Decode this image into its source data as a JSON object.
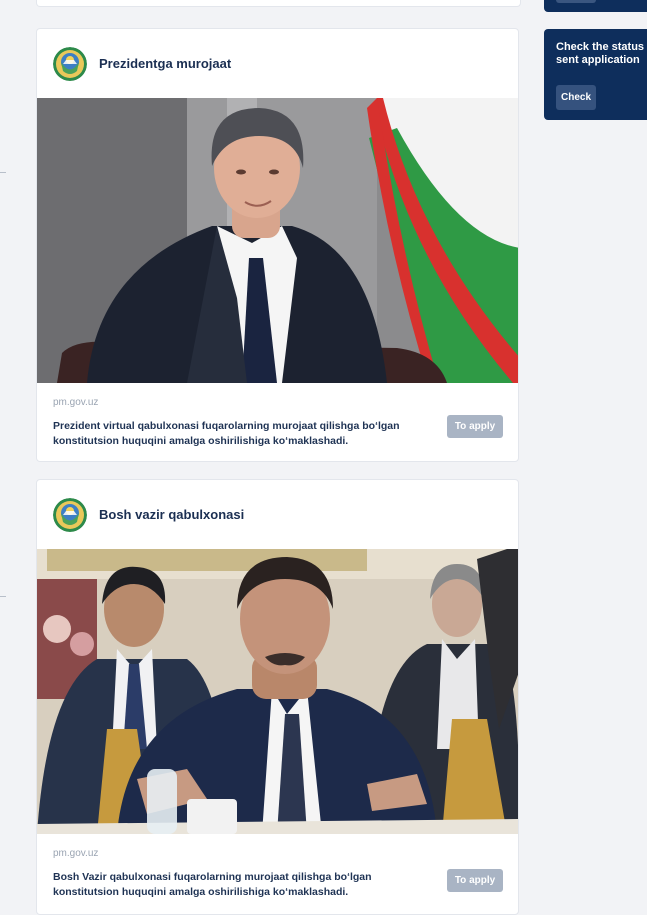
{
  "cards": [
    {
      "title": "Prezidentga murojaat",
      "source": "pm.gov.uz",
      "description": "Prezident virtual qabulxonasi fuqarolarning murojaat qilishga bo‘lgan konstitutsion huquqini amalga oshirilishiga ko‘maklashadi.",
      "apply_label": "To apply"
    },
    {
      "title": "Bosh vazir qabulxonasi",
      "source": "pm.gov.uz",
      "description": "Bosh Vazir qabulxonasi fuqarolarning murojaat qilishga bo‘lgan konstitutsion huquqini amalga oshirilishiga ko‘maklashadi.",
      "apply_label": "To apply"
    }
  ],
  "status_panel": {
    "text_line1": "Check the status of",
    "text_line2": "sent application",
    "check_label": "Check"
  },
  "colors": {
    "navy": "#0e2e5c",
    "button_gray": "#a9b4c4",
    "flag_green": "#2f9a45",
    "flag_red": "#d8312e"
  }
}
